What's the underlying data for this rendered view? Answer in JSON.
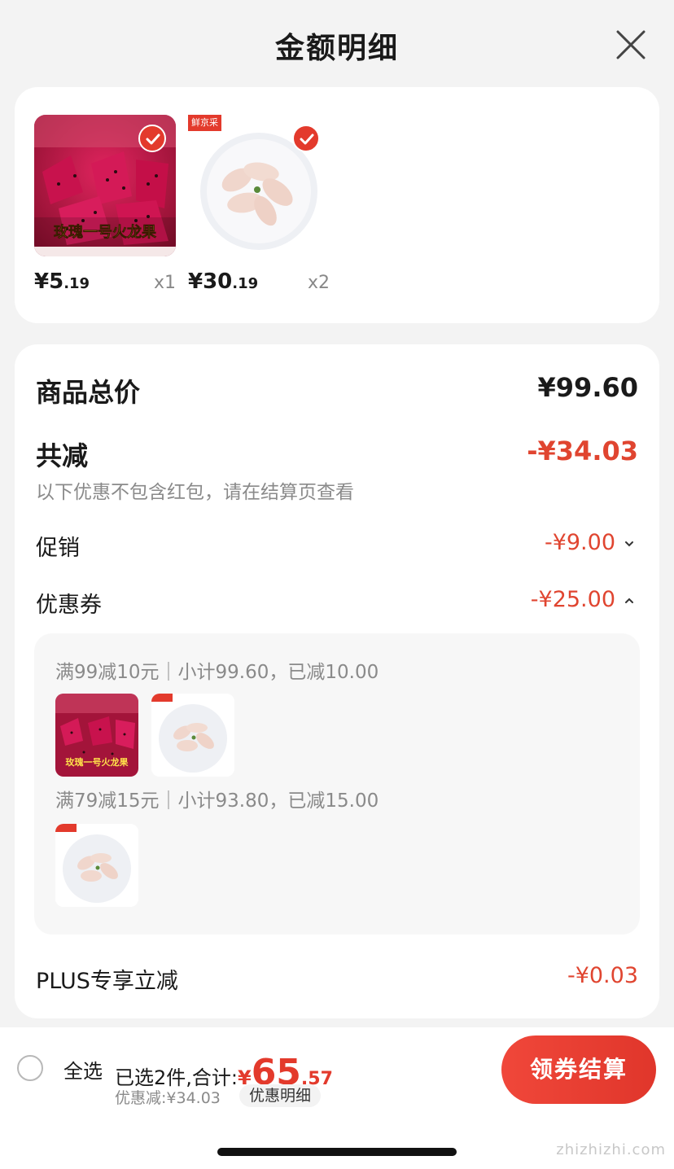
{
  "header": {
    "title": "金额明细"
  },
  "products": [
    {
      "price_int": "¥5",
      "price_dec": ".19",
      "qty": "x1",
      "image_text": "玫瑰一号火龙果",
      "tag": ""
    },
    {
      "price_int": "¥30",
      "price_dec": ".19",
      "qty": "x2",
      "image_text": "",
      "tag": "鲜京采"
    }
  ],
  "summary": {
    "goods_total_label": "商品总价",
    "goods_total_value": "¥99.60",
    "total_reduce_label": "共减",
    "total_reduce_value": "-¥34.03",
    "notice": "以下优惠不包含红包，请在结算页查看",
    "promo_label": "促销",
    "promo_value": "-¥9.00",
    "coupon_label": "优惠券",
    "coupon_value": "-¥25.00",
    "plus_label": "PLUS专享立减",
    "plus_value": "-¥0.03"
  },
  "coupons": [
    {
      "rule": "满99减10元｜小计99.60，已减10.00"
    },
    {
      "rule": "满79减15元｜小计93.80，已减15.00"
    }
  ],
  "bottom_bar": {
    "select_all": "全选",
    "selected_text": "已选2件,合计:",
    "total_yen": "¥",
    "total_int": "65",
    "total_dec": ".57",
    "discount_text": "优惠减:¥34.03",
    "detail_button": "优惠明细",
    "pay_button": "领券结算"
  },
  "watermark": "zhizhizhi.com",
  "colors": {
    "accent": "#e33a2c",
    "price_red": "#e04530"
  }
}
